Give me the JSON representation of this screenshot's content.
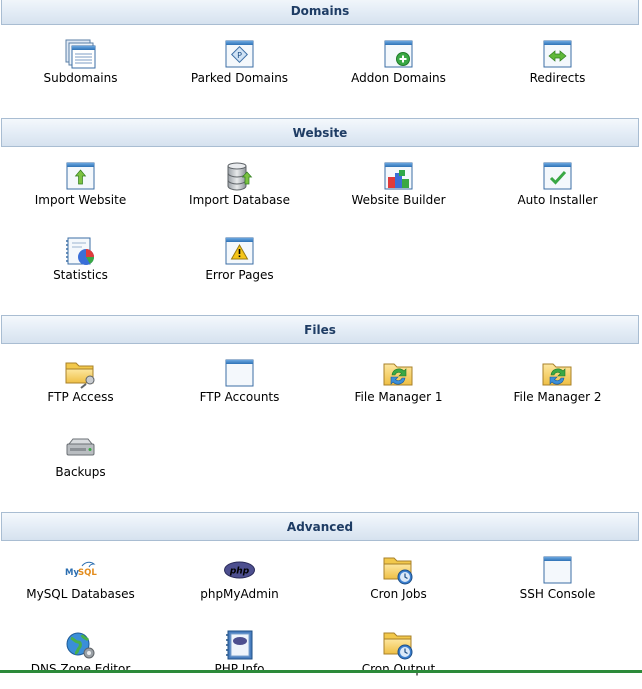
{
  "sections": {
    "domains": {
      "title": "Domains",
      "items": [
        {
          "label": "Subdomains",
          "icon": "subdomains-icon"
        },
        {
          "label": "Parked Domains",
          "icon": "parked-domains-icon"
        },
        {
          "label": "Addon Domains",
          "icon": "addon-domains-icon"
        },
        {
          "label": "Redirects",
          "icon": "redirects-icon"
        }
      ]
    },
    "website": {
      "title": "Website",
      "items": [
        {
          "label": "Import Website",
          "icon": "import-website-icon"
        },
        {
          "label": "Import Database",
          "icon": "import-database-icon"
        },
        {
          "label": "Website Builder",
          "icon": "website-builder-icon"
        },
        {
          "label": "Auto Installer",
          "icon": "auto-installer-icon"
        },
        {
          "label": "Statistics",
          "icon": "statistics-icon"
        },
        {
          "label": "Error Pages",
          "icon": "error-pages-icon"
        }
      ]
    },
    "files": {
      "title": "Files",
      "items": [
        {
          "label": "FTP Access",
          "icon": "ftp-access-icon"
        },
        {
          "label": "FTP Accounts",
          "icon": "ftp-accounts-icon"
        },
        {
          "label": "File Manager 1",
          "icon": "file-manager-icon"
        },
        {
          "label": "File Manager 2",
          "icon": "file-manager-icon"
        },
        {
          "label": "Backups",
          "icon": "backups-icon"
        }
      ]
    },
    "advanced": {
      "title": "Advanced",
      "items": [
        {
          "label": "MySQL Databases",
          "icon": "mysql-icon"
        },
        {
          "label": "phpMyAdmin",
          "icon": "phpmyadmin-icon"
        },
        {
          "label": "Cron Jobs",
          "icon": "cron-jobs-icon"
        },
        {
          "label": "SSH Console",
          "icon": "ssh-console-icon"
        },
        {
          "label": "DNS Zone Editor",
          "icon": "dns-zone-editor-icon"
        },
        {
          "label": "PHP Info",
          "icon": "php-info-icon"
        },
        {
          "label": "Cron Output",
          "icon": "cron-output-icon"
        }
      ]
    }
  },
  "colors": {
    "header_text": "#1e3c64",
    "header_border": "#a9bdd2",
    "window_blue": "#3b82c4",
    "folder_yellow": "#f2c84b",
    "bottom_bar": "#2c8a3a"
  }
}
